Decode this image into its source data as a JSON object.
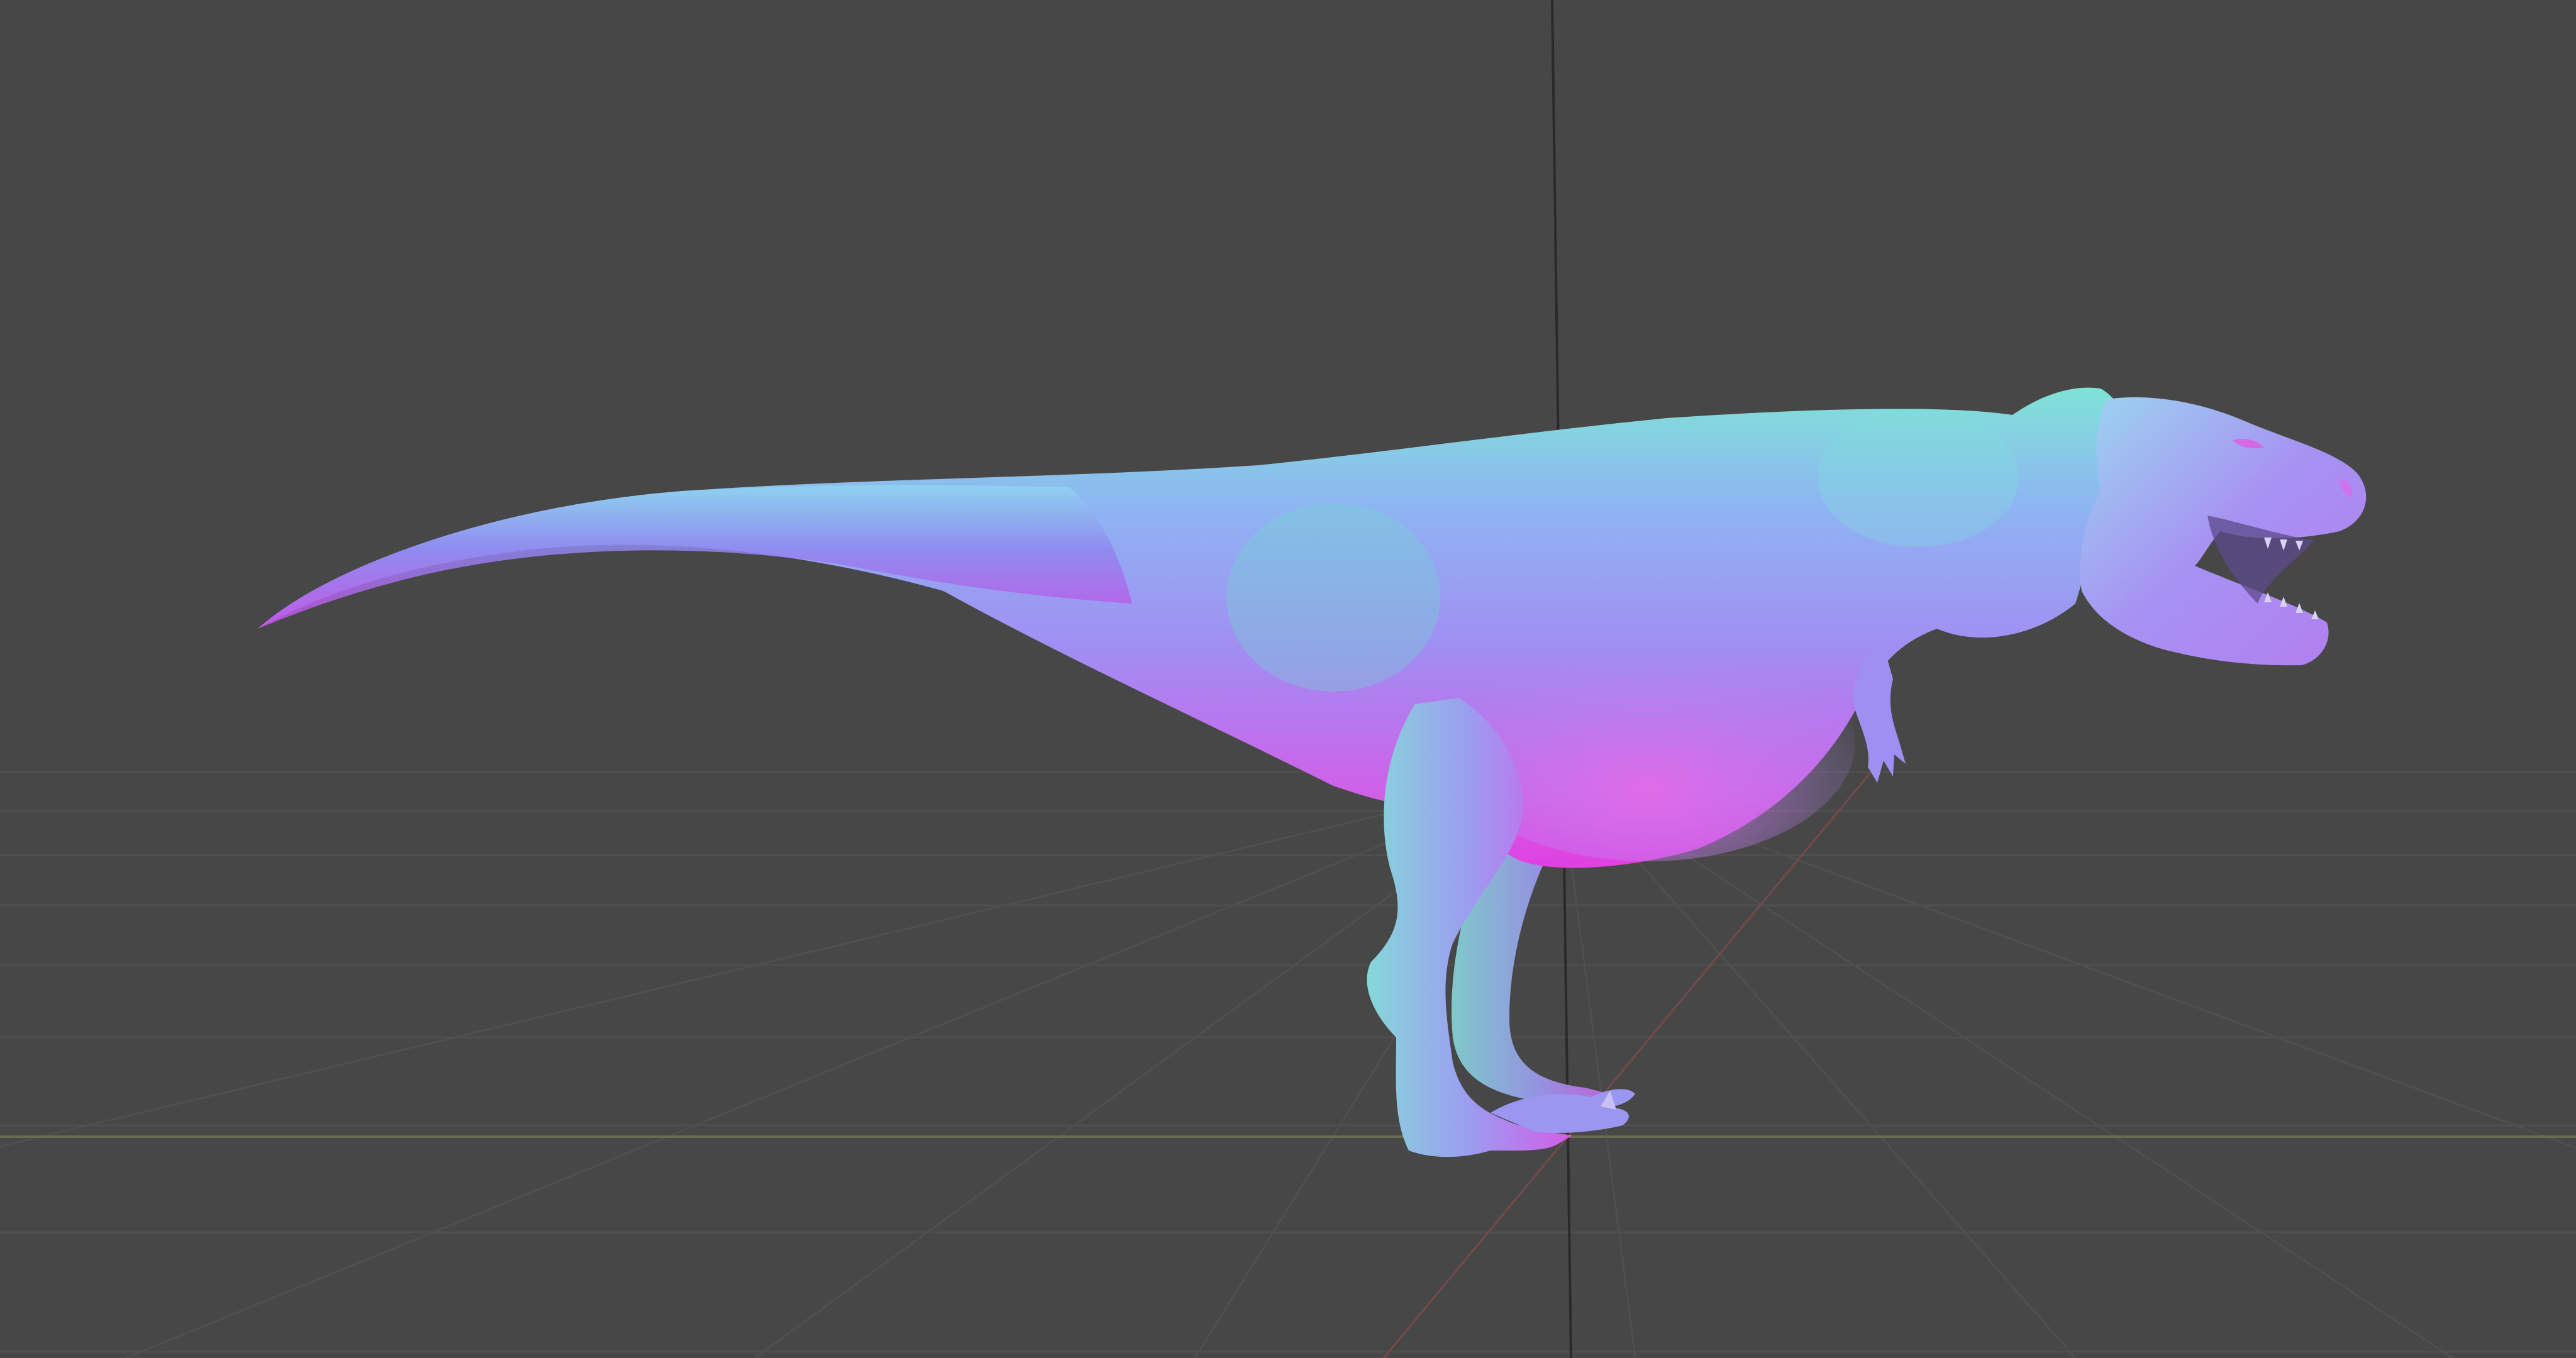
{
  "viewport": {
    "background_color": "#474747",
    "grid_line_color": "#4f4f4f",
    "horizon_axis_color": "#6b6a55",
    "vertical_axis_color": "#2a2a2a",
    "red_axis_color": "#8a4a4a"
  },
  "model": {
    "shading": "normal-map",
    "colors": {
      "magenta": "#e03fe6",
      "violet": "#8a5cf2",
      "lavender": "#a99bf4",
      "cyan": "#5ad9d0",
      "blue": "#5f7cf5"
    }
  }
}
